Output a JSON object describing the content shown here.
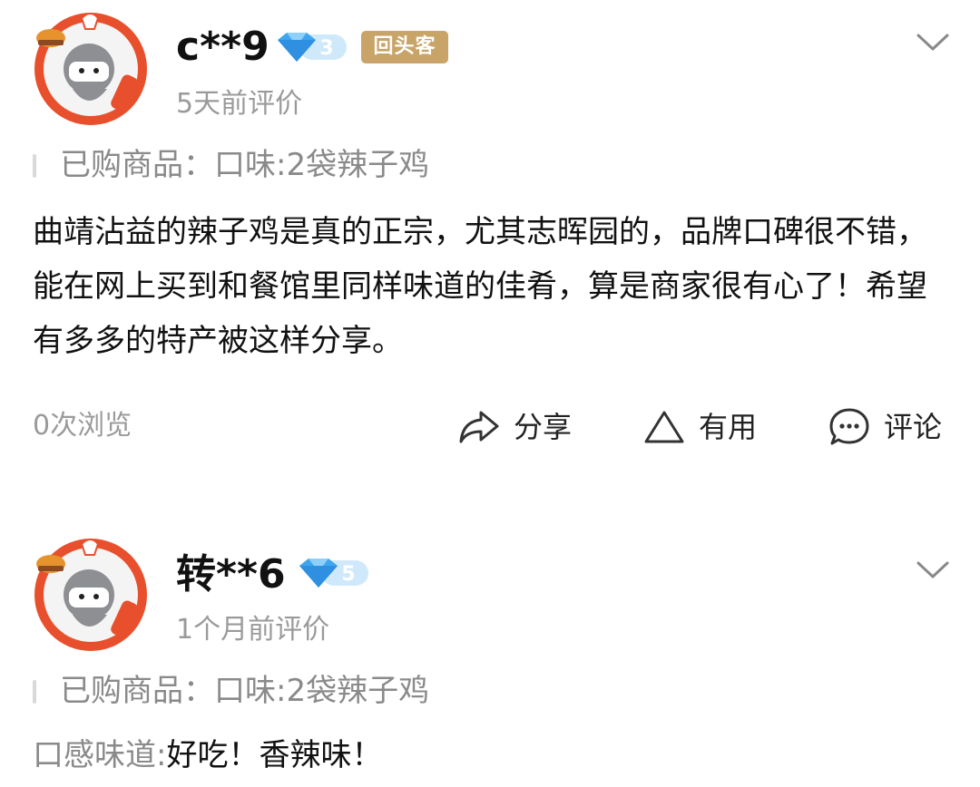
{
  "reviews": [
    {
      "username": "c**9",
      "level": "3",
      "badge": "回头客",
      "time": "5天前评价",
      "purchase": "已购商品：口味:2袋辣子鸡",
      "body": "曲靖沾益的辣子鸡是真的正宗，尤其志晖园的，品牌口碑很不错，能在网上买到和餐馆里同样味道的佳肴，算是商家很有心了！希望有多多的特产被这样分享。",
      "views": "0次浏览",
      "actions": {
        "share": "分享",
        "useful": "有用",
        "comment": "评论"
      }
    },
    {
      "username": "转**6",
      "level": "5",
      "time": "1个月前评价",
      "purchase": "已购商品：口味:2袋辣子鸡",
      "taste_label": "口感味道:",
      "taste_value": "好吃！香辣味！"
    }
  ],
  "colors": {
    "badge_gold": "#c8a468",
    "diamond_blue": "#3ea6f0",
    "muted_text": "#9a9a9a",
    "avatar_red": "#e8502d"
  },
  "icons": [
    "user-avatar",
    "diamond-level-icon",
    "chevron-down-icon",
    "share-icon",
    "triangle-useful-icon",
    "comment-bubble-icon"
  ]
}
